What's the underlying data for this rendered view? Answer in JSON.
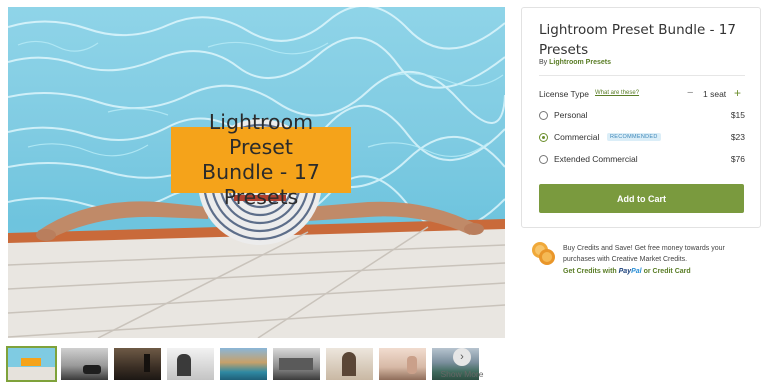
{
  "hero": {
    "overlay_line1": "Lightroom Preset",
    "overlay_line2": "Bundle - 17 Presets",
    "overlay_color": "#f5a31a"
  },
  "thumbnails": {
    "count": 9,
    "active_index": 0,
    "show_more_label": "Show More",
    "show_more_icon": "chevron-right-icon"
  },
  "product": {
    "title": "Lightroom Preset Bundle - 17 Presets",
    "by_prefix": "By",
    "author": "Lightroom Presets",
    "license_type_label": "License Type",
    "license_help": "What are these?",
    "seats": "1 seat",
    "minus_label": "−",
    "plus_label": "+",
    "options": [
      {
        "name": "Personal",
        "price": "$15",
        "selected": false
      },
      {
        "name": "Commercial",
        "badge": "RECOMMENDED",
        "price": "$23",
        "selected": true
      },
      {
        "name": "Extended Commercial",
        "price": "$76",
        "selected": false
      }
    ],
    "add_to_cart": "Add to Cart",
    "accent_color": "#7a9a3e"
  },
  "credits": {
    "promo_text": "Buy Credits and Save! Get free money towards your purchases with Creative Market Credits.",
    "get_credits_prefix": "Get Credits with",
    "paypal_part1": "Pay",
    "paypal_part2": "Pal",
    "credit_card": "or Credit Card",
    "icon": "coins-icon"
  }
}
